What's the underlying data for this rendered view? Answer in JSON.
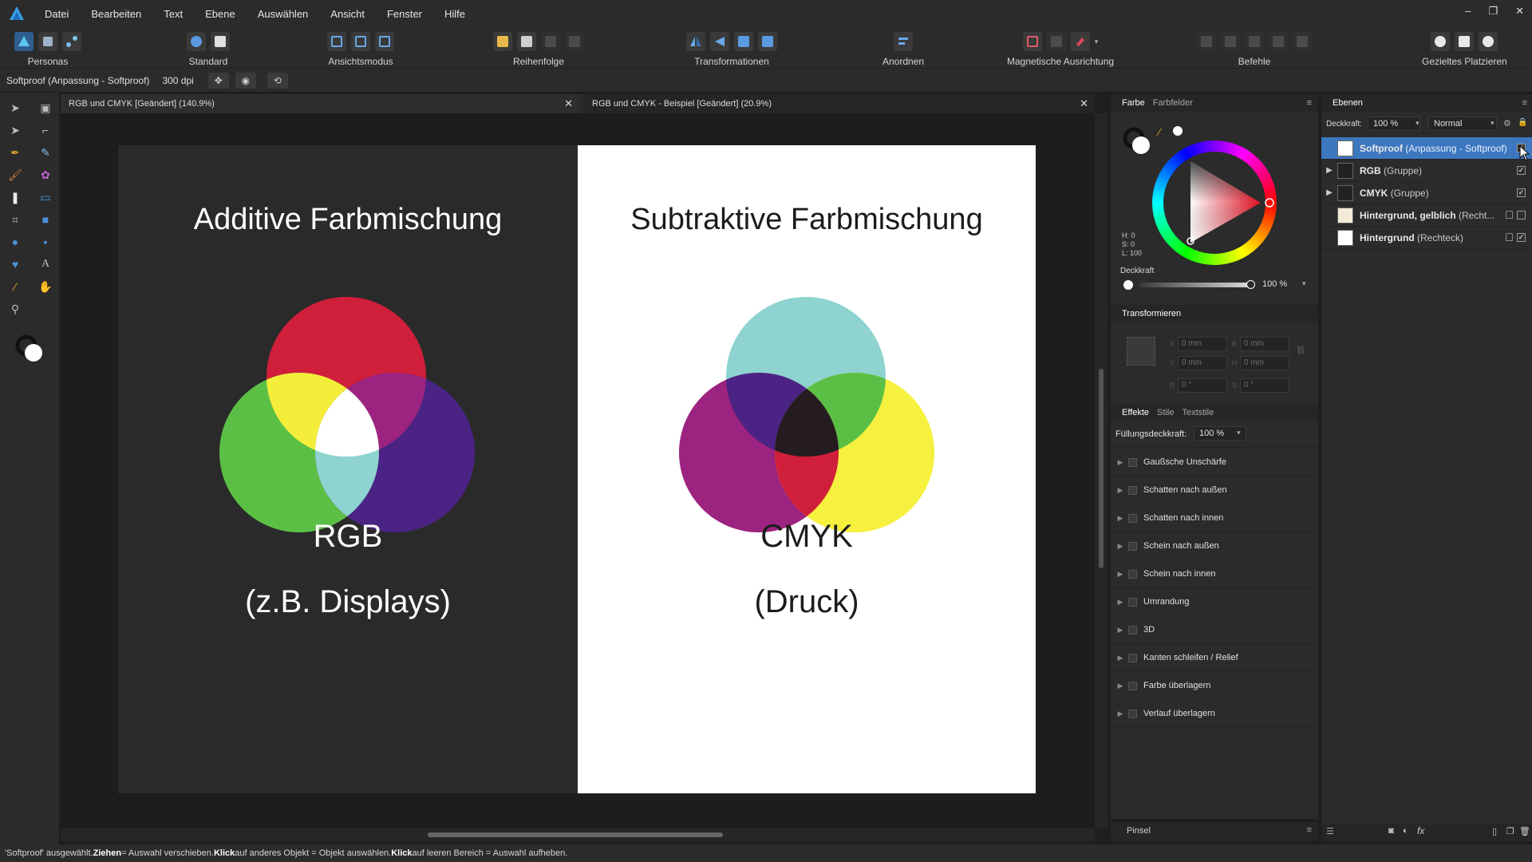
{
  "menu": {
    "items": [
      "Datei",
      "Bearbeiten",
      "Text",
      "Ebene",
      "Auswählen",
      "Ansicht",
      "Fenster",
      "Hilfe"
    ]
  },
  "toolbar": {
    "personas": "Personas",
    "standard": "Standard",
    "ansichtsmodus": "Ansichtsmodus",
    "reihenfolge": "Reihenfolge",
    "transformationen": "Transformationen",
    "anordnen": "Anordnen",
    "magnetische": "Magnetische Ausrichtung",
    "befehle": "Befehle",
    "gezieltes": "Gezieltes Platzieren"
  },
  "context": {
    "selection": "Softproof (Anpassung - Softproof)",
    "dpi": "300 dpi"
  },
  "tabs": [
    {
      "label": "RGB und CMYK [Geändert] (140.9%)"
    },
    {
      "label": "RGB und CMYK - Beispiel [Geändert] (20.9%)"
    }
  ],
  "canvas": {
    "left_title": "Additive Farbmischung",
    "left_label": "RGB",
    "left_sub": "(z.B. Displays)",
    "right_title": "Subtraktive Farbmischung",
    "right_label": "CMYK",
    "right_sub": "(Druck)",
    "colors": {
      "red": "#d01f3a",
      "green": "#5cbf45",
      "blue": "#4a2384",
      "yellow": "#f4ee3a",
      "white": "#ffffff",
      "cyan": "#8ed3cf",
      "magenta": "#9c237f",
      "cmyk_yellow": "#f6f03f",
      "black": "#241c20"
    }
  },
  "color_panel": {
    "tab_active": "Farbe",
    "tab_inactive": "Farbfelder",
    "h": "H: 0",
    "s": "S: 0",
    "l": "L: 100",
    "opacity_label": "Deckkraft",
    "opacity_value": "100 %"
  },
  "transform_panel": {
    "title": "Transformieren",
    "x": "0 mm",
    "y": "0 mm",
    "w": "0 mm",
    "h": "0 mm",
    "r": "0 °",
    "s": "0 °"
  },
  "effects_panel": {
    "tab_active": "Effekte",
    "tab2": "Stile",
    "tab3": "Textstile",
    "fill_label": "Füllungsdeckkraft:",
    "fill_value": "100 %",
    "items": [
      "Gaußsche Unschärfe",
      "Schatten nach außen",
      "Schatten nach innen",
      "Schein nach außen",
      "Schein nach innen",
      "Umrandung",
      "3D",
      "Kanten schleifen / Relief",
      "Farbe überlagern",
      "Verlauf überlagern"
    ]
  },
  "brush_panel": {
    "title": "Pinsel"
  },
  "layers_panel": {
    "title": "Ebenen",
    "opacity_label": "Deckkraft:",
    "opacity_value": "100 %",
    "blend_mode": "Normal",
    "layers": [
      {
        "name": "Softproof",
        "type": "(Anpassung - Softproof)"
      },
      {
        "name": "RGB",
        "type": "(Gruppe)"
      },
      {
        "name": "CMYK",
        "type": "(Gruppe)"
      },
      {
        "name": "Hintergrund, gelblich",
        "type": "(Recht..."
      },
      {
        "name": "Hintergrund",
        "type": "(Rechteck)"
      }
    ]
  },
  "status": {
    "p1": "'Softproof' ausgewählt. ",
    "b1": "Ziehen",
    "p2": " = Auswahl verschieben. ",
    "b2": "Klick",
    "p3": " auf anderes Objekt = Objekt auswählen. ",
    "b3": "Klick",
    "p4": " auf leeren Bereich = Auswahl aufheben."
  }
}
